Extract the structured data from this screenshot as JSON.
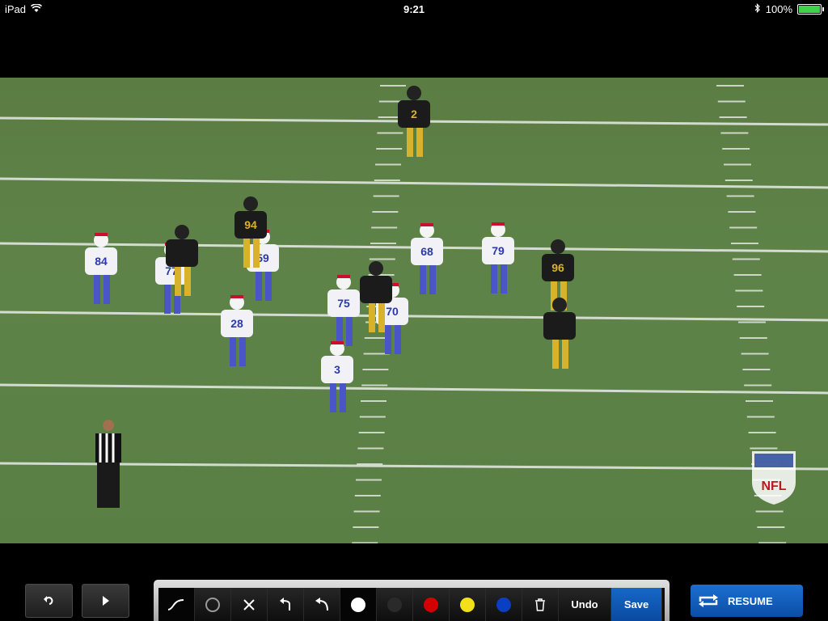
{
  "status_bar": {
    "device": "iPad",
    "time": "9:21",
    "battery": "100%",
    "battery_level": 1.0,
    "icons": [
      "wifi-icon",
      "bluetooth-icon",
      "battery-icon"
    ]
  },
  "video": {
    "watermark": "NFL",
    "jersey_numbers": [
      "84",
      "77",
      "59",
      "28",
      "75",
      "70",
      "68",
      "79",
      "3",
      "2",
      "94",
      "96"
    ]
  },
  "controls": {
    "back_icon": "return-icon",
    "play_icon": "play-icon"
  },
  "toolbar": {
    "tools": [
      "freehand-icon",
      "circle-icon",
      "x-mark-icon",
      "arrow-curve-icon",
      "arrow-left-curve-icon"
    ],
    "colors": [
      "#ffffff",
      "#2a2a2a",
      "#d40000",
      "#f2e01a",
      "#0a3fc2"
    ],
    "trash_icon": "trash-icon",
    "undo_label": "Undo",
    "save_label": "Save"
  },
  "resume": {
    "label": "RESUME",
    "icon": "repeat-icon"
  }
}
